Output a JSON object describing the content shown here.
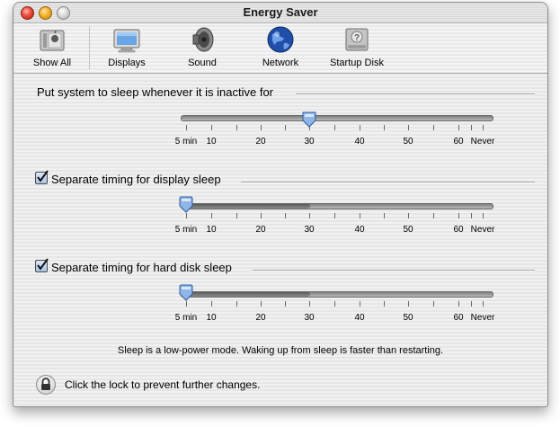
{
  "window": {
    "title": "Energy Saver"
  },
  "toolbar": {
    "items": [
      {
        "label": "Show All",
        "icon": "show-all-icon"
      },
      {
        "label": "Displays",
        "icon": "display-icon"
      },
      {
        "label": "Sound",
        "icon": "speaker-icon"
      },
      {
        "label": "Network",
        "icon": "globe-icon"
      },
      {
        "label": "Startup Disk",
        "icon": "startup-disk-icon"
      }
    ]
  },
  "system_sleep": {
    "label": "Put system to sleep whenever it is inactive for",
    "value": "30"
  },
  "display_sleep": {
    "label": "Separate timing for display sleep",
    "checked": true,
    "value": "5 min"
  },
  "disk_sleep": {
    "label": "Separate timing for hard disk sleep",
    "checked": true,
    "value": "5 min"
  },
  "scale": {
    "labels": [
      "5 min",
      "10",
      "20",
      "30",
      "40",
      "50",
      "60",
      "Never"
    ]
  },
  "footer": {
    "note": "Sleep is a low-power mode. Waking up from sleep is faster than restarting.",
    "lock_text": "Click the lock to prevent further changes."
  },
  "colors": {
    "close": "#ec4b3c",
    "minimize": "#f3b12c",
    "checkbox": "#a9c5ea",
    "thumb": "#8fb6e6"
  }
}
